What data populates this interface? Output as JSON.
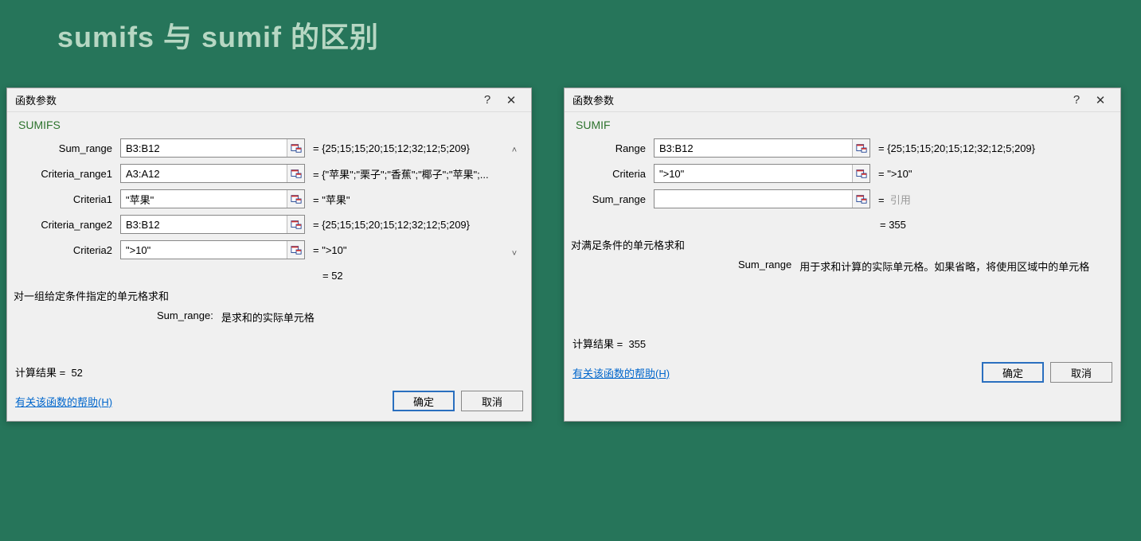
{
  "page_title": "sumifs 与 sumif 的区别",
  "dialog1": {
    "title": "函数参数",
    "help_btn": "?",
    "close_btn": "✕",
    "func_name": "SUMIFS",
    "params": [
      {
        "label": "Sum_range",
        "value": "B3:B12",
        "eval": "= {25;15;15;20;15;12;32;12;5;209}"
      },
      {
        "label": "Criteria_range1",
        "value": "A3:A12",
        "eval": "= {\"苹果\";\"栗子\";\"香蕉\";\"椰子\";\"苹果\";..."
      },
      {
        "label": "Criteria1",
        "value": "\"苹果\"",
        "eval": "= \"苹果\""
      },
      {
        "label": "Criteria_range2",
        "value": "B3:B12",
        "eval": "= {25;15;15;20;15;12;32;12;5;209}"
      },
      {
        "label": "Criteria2",
        "value": "\">10\"",
        "eval": "= \">10\""
      }
    ],
    "scroll_up": "˄",
    "scroll_down": "˅",
    "result_inline": "= 52",
    "desc": "对一组给定条件指定的单元格求和",
    "param_desc_label": "Sum_range:",
    "param_desc_text": "是求和的实际单元格",
    "calc_result_label": "计算结果 =",
    "calc_result_value": "52",
    "help_link": "有关该函数的帮助(H)",
    "ok": "确定",
    "cancel": "取消"
  },
  "dialog2": {
    "title": "函数参数",
    "help_btn": "?",
    "close_btn": "✕",
    "func_name": "SUMIF",
    "params": [
      {
        "label": "Range",
        "value": "B3:B12",
        "eval": "= {25;15;15;20;15;12;32;12;5;209}"
      },
      {
        "label": "Criteria",
        "value": "\">10\"",
        "eval": "= \">10\""
      },
      {
        "label": "Sum_range",
        "value": "",
        "eval": "=",
        "placeholder": "引用"
      }
    ],
    "result_inline": "= 355",
    "desc": "对满足条件的单元格求和",
    "param_desc_label": "Sum_range",
    "param_desc_text": "用于求和计算的实际单元格。如果省略，将使用区域中的单元格",
    "calc_result_label": "计算结果 =",
    "calc_result_value": "355",
    "help_link": "有关该函数的帮助(H)",
    "ok": "确定",
    "cancel": "取消"
  },
  "icon_tooltip": "collapse-dialog"
}
